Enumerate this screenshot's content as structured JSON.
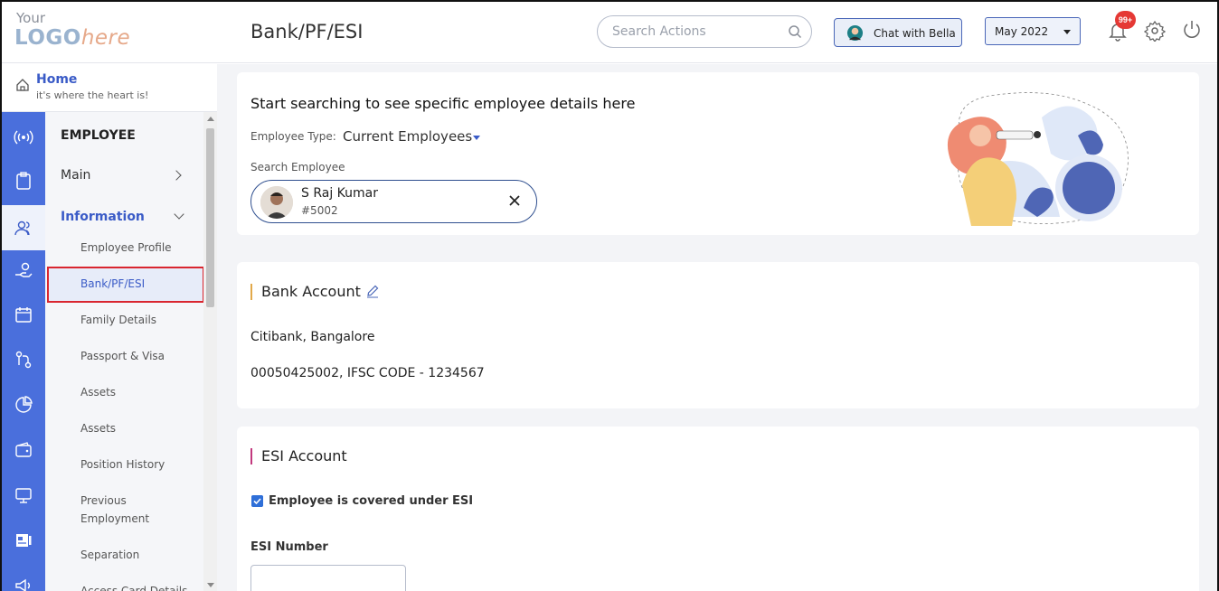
{
  "header": {
    "logo_line1": "Your",
    "logo_line2_a": "LOGO",
    "logo_line2_b": "here",
    "page_title": "Bank/PF/ESI",
    "search_placeholder": "Search Actions",
    "chat_label": "Chat with Bella",
    "month_selected": "May 2022",
    "notification_badge": "99+"
  },
  "home": {
    "title": "Home",
    "subtitle": "it's where the heart is!"
  },
  "rail": {
    "items": [
      "broadcast-icon",
      "clipboard-icon",
      "users-icon",
      "hand-money-icon",
      "calendar-icon",
      "route-icon",
      "pie-chart-icon",
      "wallet-icon",
      "monitor-icon",
      "id-card-icon",
      "megaphone-icon"
    ],
    "active_index": 2
  },
  "menu": {
    "section": "EMPLOYEE",
    "group_main": "Main",
    "group_information": "Information",
    "items": [
      "Employee Profile",
      "Bank/PF/ESI",
      "Family Details",
      "Passport & Visa",
      "Assets",
      "Assets",
      "Position History",
      "Previous Employment",
      "Separation",
      "Access Card Details"
    ],
    "selected_index": 1
  },
  "search_card": {
    "title": "Start searching to see specific employee details here",
    "employee_type_label": "Employee Type:",
    "employee_type_value": "Current Employees",
    "search_label": "Search Employee",
    "employee_name": "S Raj Kumar",
    "employee_id": "#5002"
  },
  "bank_card": {
    "title": "Bank Account",
    "bank_name": "Citibank, Bangalore",
    "account_line": "00050425002, IFSC CODE - 1234567"
  },
  "esi_card": {
    "title": "ESI Account",
    "covered_label": "Employee is covered under ESI",
    "covered_checked": true,
    "esi_number_label": "ESI Number",
    "esi_number_value": ""
  },
  "colors": {
    "rail": "#4a6fdc",
    "accent": "#3a5bc7",
    "badge": "#e53935",
    "selection_border": "#d9262f"
  }
}
